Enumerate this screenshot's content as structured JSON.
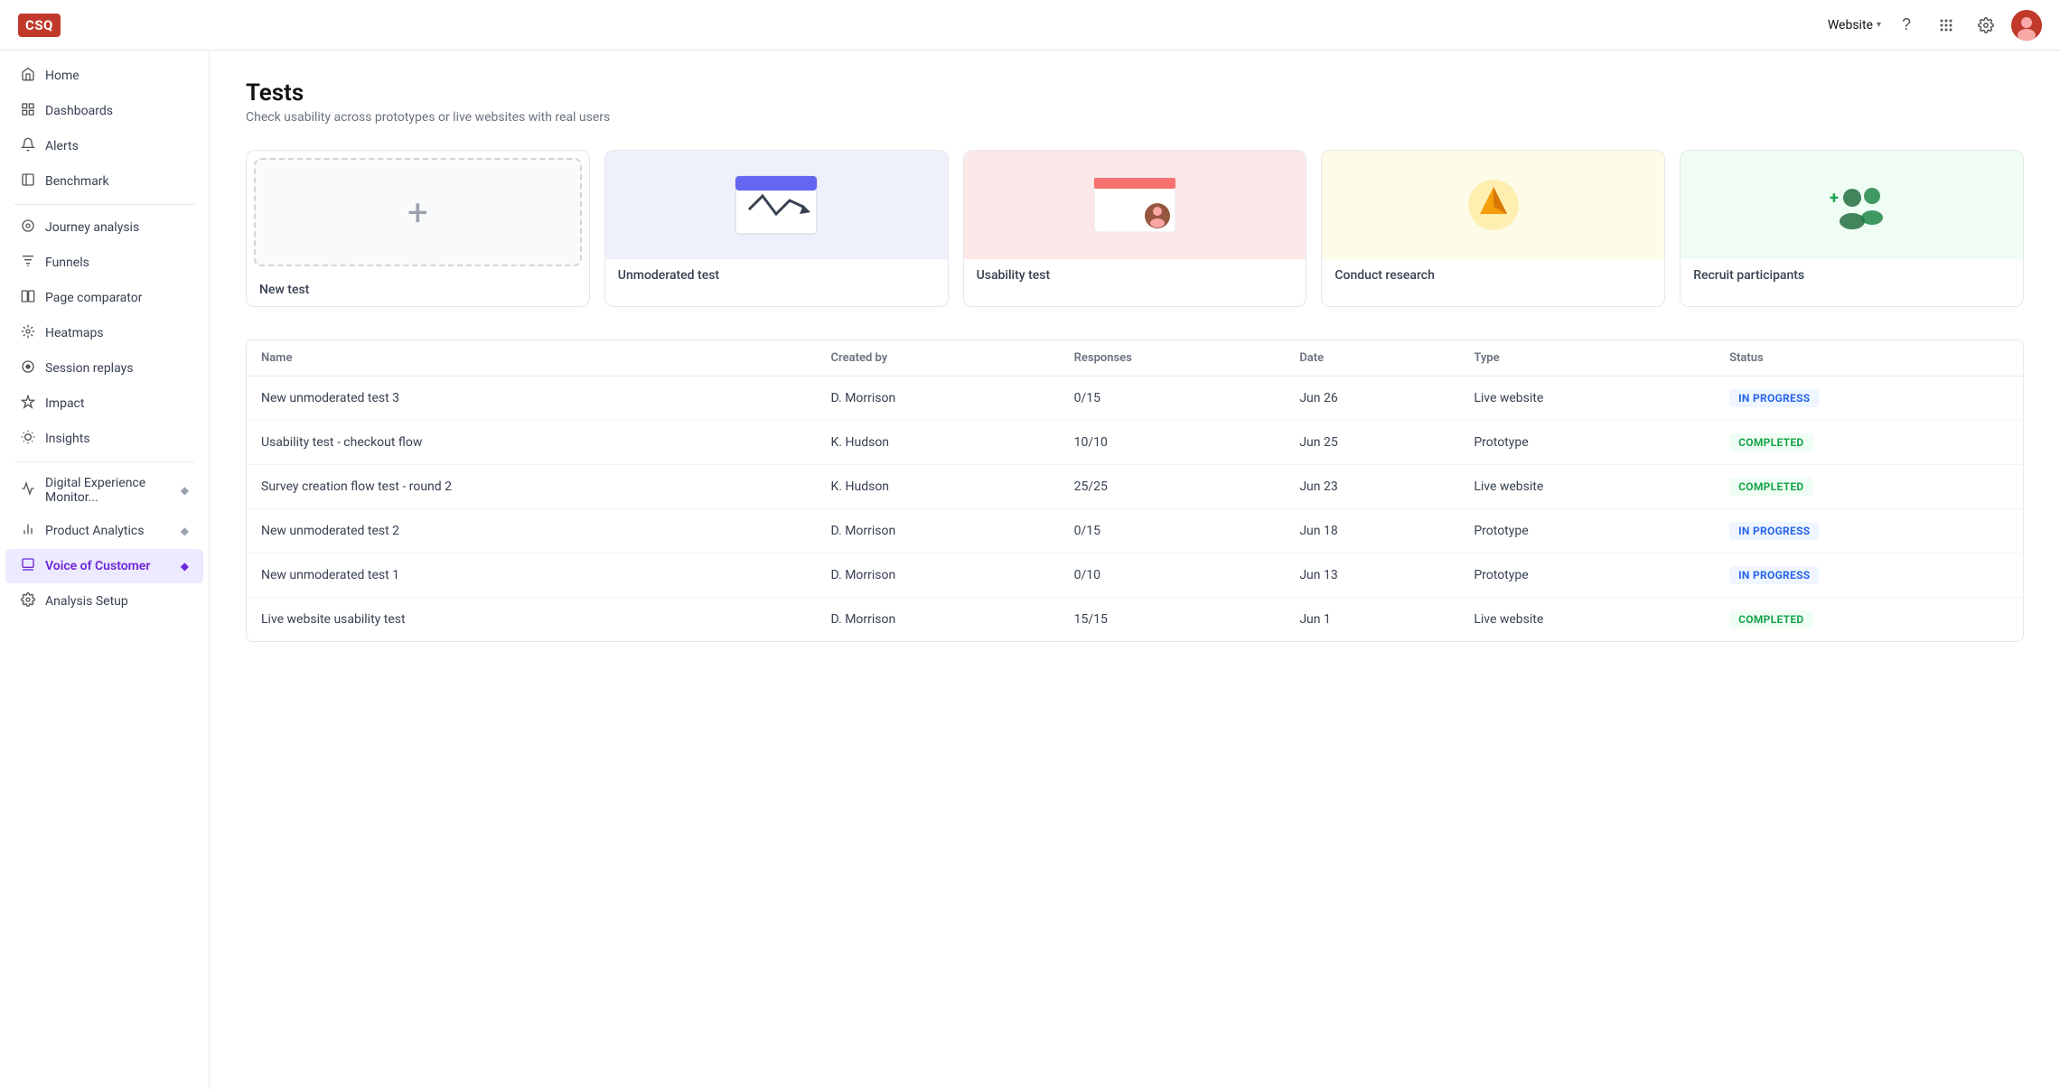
{
  "topnav": {
    "logo": "CSQ",
    "workspace": "Website",
    "icons": {
      "help": "?",
      "grid": "⠿",
      "settings": "⚙"
    }
  },
  "sidebar": {
    "items": [
      {
        "id": "home",
        "label": "Home",
        "icon": "⌂",
        "active": false
      },
      {
        "id": "dashboards",
        "label": "Dashboards",
        "icon": "▦",
        "active": false
      },
      {
        "id": "alerts",
        "label": "Alerts",
        "icon": "🔔",
        "active": false
      },
      {
        "id": "benchmark",
        "label": "Benchmark",
        "icon": "◫",
        "active": false
      },
      {
        "id": "journey-analysis",
        "label": "Journey analysis",
        "icon": "◎",
        "active": false
      },
      {
        "id": "funnels",
        "label": "Funnels",
        "icon": "📊",
        "active": false
      },
      {
        "id": "page-comparator",
        "label": "Page comparator",
        "icon": "⊞",
        "active": false
      },
      {
        "id": "heatmaps",
        "label": "Heatmaps",
        "icon": "✳",
        "active": false
      },
      {
        "id": "session-replays",
        "label": "Session replays",
        "icon": "◉",
        "active": false
      },
      {
        "id": "impact",
        "label": "Impact",
        "icon": "◇",
        "active": false
      },
      {
        "id": "insights",
        "label": "Insights",
        "icon": "💡",
        "active": false
      },
      {
        "id": "digital-experience",
        "label": "Digital Experience Monitor...",
        "icon": "≈",
        "active": false,
        "badge": "◆"
      },
      {
        "id": "product-analytics",
        "label": "Product Analytics",
        "icon": "⌇",
        "active": false,
        "badge": "◆"
      },
      {
        "id": "voice-of-customer",
        "label": "Voice of Customer",
        "icon": "◫",
        "active": true,
        "badge": "◆"
      },
      {
        "id": "analysis-setup",
        "label": "Analysis Setup",
        "icon": "⚙",
        "active": false
      }
    ]
  },
  "page": {
    "title": "Tests",
    "subtitle": "Check usability across prototypes or live websites with real users"
  },
  "cards": [
    {
      "id": "new-test",
      "label": "New test",
      "type": "new"
    },
    {
      "id": "unmoderated-test",
      "label": "Unmoderated test",
      "type": "unmoderated"
    },
    {
      "id": "usability-test",
      "label": "Usability test",
      "type": "usability"
    },
    {
      "id": "conduct-research",
      "label": "Conduct research",
      "type": "research"
    },
    {
      "id": "recruit-participants",
      "label": "Recruit participants",
      "type": "recruit"
    }
  ],
  "table": {
    "columns": [
      "Name",
      "Created by",
      "Responses",
      "Date",
      "Type",
      "Status"
    ],
    "rows": [
      {
        "name": "New unmoderated test 3",
        "createdBy": "D. Morrison",
        "responses": "0/15",
        "date": "Jun 26",
        "type": "Live website",
        "status": "IN PROGRESS",
        "statusClass": "in-progress"
      },
      {
        "name": "Usability test - checkout flow",
        "createdBy": "K. Hudson",
        "responses": "10/10",
        "date": "Jun 25",
        "type": "Prototype",
        "status": "COMPLETED",
        "statusClass": "completed"
      },
      {
        "name": "Survey creation flow test - round 2",
        "createdBy": "K. Hudson",
        "responses": "25/25",
        "date": "Jun 23",
        "type": "Live website",
        "status": "COMPLETED",
        "statusClass": "completed"
      },
      {
        "name": "New unmoderated test 2",
        "createdBy": "D. Morrison",
        "responses": "0/15",
        "date": "Jun 18",
        "type": "Prototype",
        "status": "IN PROGRESS",
        "statusClass": "in-progress"
      },
      {
        "name": "New unmoderated test 1",
        "createdBy": "D. Morrison",
        "responses": "0/10",
        "date": "Jun 13",
        "type": "Prototype",
        "status": "IN PROGRESS",
        "statusClass": "in-progress"
      },
      {
        "name": "Live website usability test",
        "createdBy": "D. Morrison",
        "responses": "15/15",
        "date": "Jun 1",
        "type": "Live website",
        "status": "COMPLETED",
        "statusClass": "completed"
      }
    ]
  }
}
